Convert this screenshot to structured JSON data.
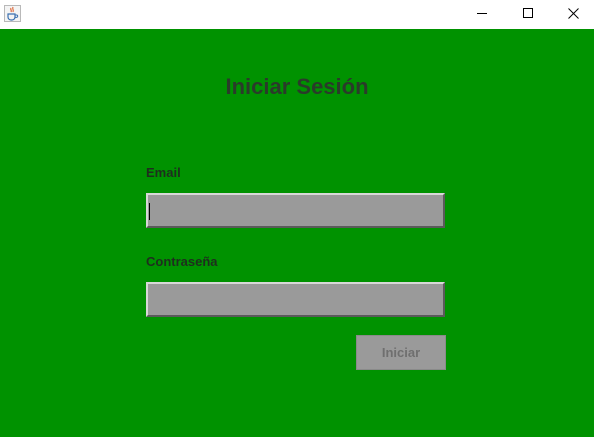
{
  "window": {
    "title_icon": "java-cup-icon",
    "controls": [
      "minimize-icon",
      "maximize-icon",
      "close-icon"
    ]
  },
  "form": {
    "title": "Iniciar Sesión",
    "email_label": "Email",
    "email_value": "",
    "password_label": "Contraseña",
    "password_value": "",
    "submit_label": "Iniciar"
  },
  "colors": {
    "background": "#009200",
    "field": "#9a9a9a",
    "text": "#2a3b2a"
  }
}
